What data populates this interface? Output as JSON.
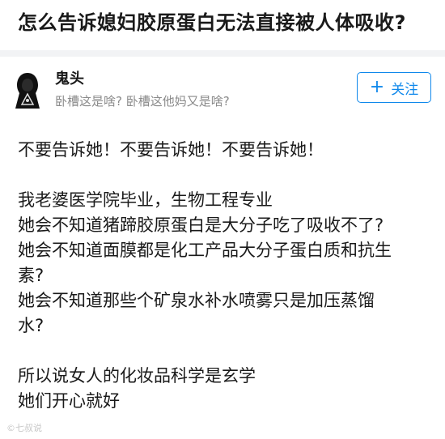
{
  "question": {
    "title": "怎么告诉媳妇胶原蛋白无法直接被人体吸收?"
  },
  "author": {
    "name": "鬼头",
    "bio": "卧槽这是啥? 卧槽这他妈又是啥?",
    "avatar_icon": "hooded-figure-avatar"
  },
  "follow_button": {
    "icon": "plus-icon",
    "plus": "+",
    "label": "关注",
    "color": "#0f88eb"
  },
  "answer": {
    "lines": [
      "不要告诉她！不要告诉她！不要告诉她！",
      "",
      "我老婆医学院毕业，生物工程专业",
      "她会不知道猪蹄胶原蛋白是大分子吃了吸收不了?",
      "她会不知道面膜都是化工产品大分子蛋白质和抗生",
      "素?",
      "她会不知道那些个矿泉水补水喷雾只是加压蒸馏",
      "水?",
      "",
      "所以说女人的化妆品科学是玄学",
      "她们开心就好"
    ]
  },
  "watermark": {
    "text": "©七叔说"
  }
}
